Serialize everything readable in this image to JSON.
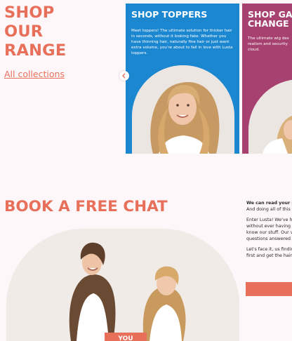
{
  "range": {
    "title_lines": [
      "SHOP",
      "OUR",
      "RANGE"
    ],
    "all_collections": "All collections"
  },
  "cards": [
    {
      "title": "SHOP TOPPERS",
      "description": "Meet toppers! The ultimate solution for thicker hair in seconds, without it looking fake. Whether you have thinning hair, naturally fine hair or just want extra volume, you're about to fall in love with Lusta toppers.",
      "color": "#1b87d1"
    },
    {
      "title_lines": [
        "SHOP GA",
        "CHANGE"
      ],
      "description_lines": [
        "The ultimate wig des",
        "realism and security",
        "cloud."
      ],
      "color": "#a64170"
    }
  ],
  "chat": {
    "title": "BOOK A FREE CHAT",
    "body": [
      {
        "text": "We can read your m",
        "bold": true
      },
      {
        "text": "And doing all of this",
        "bold": false
      },
      {
        "gap": true
      },
      {
        "text": "Enter Lusta! We've h",
        "bold": false
      },
      {
        "text": "without ever having",
        "bold": false
      },
      {
        "text": "know our stuff. Our v",
        "bold": false
      },
      {
        "text": "questions answered",
        "bold": false
      },
      {
        "gap": true
      },
      {
        "text": "Let's face it, us findin",
        "bold": false
      },
      {
        "text": "first and get the hair",
        "bold": false
      }
    ],
    "photo_badge": "YOU"
  },
  "colors": {
    "accent": "#e8705a",
    "background": "#fdf7fa",
    "blue_card": "#1b87d1",
    "magenta_card": "#a64170"
  },
  "icons": {
    "prev": "chevron-left-icon"
  }
}
